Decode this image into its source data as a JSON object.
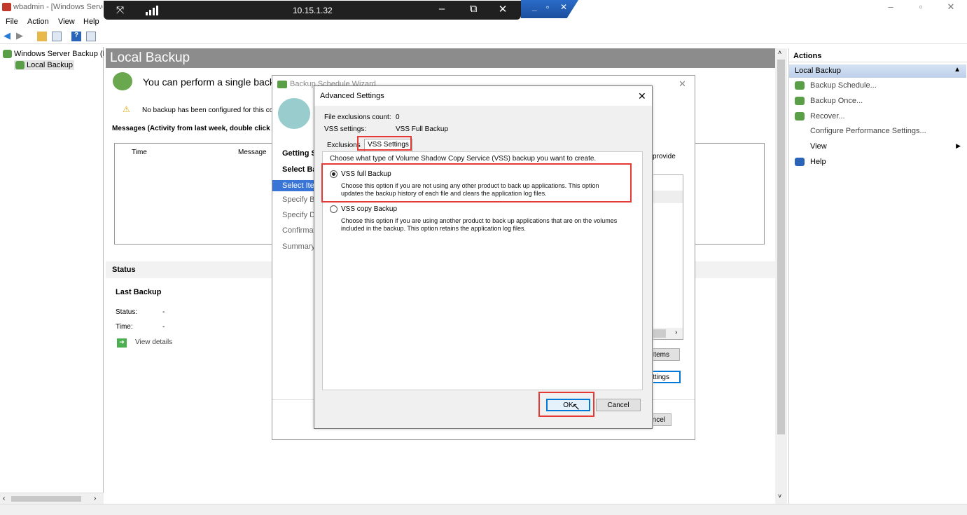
{
  "window": {
    "title": "wbadmin - [Windows Server Backup (Local)\\Local Backup]",
    "minimize_icon": "minimize-icon",
    "restore_icon": "restore-icon",
    "close_icon": "close-icon"
  },
  "remote_bar": {
    "ip": "10.15.1.32",
    "pin_icon": "unpin-icon",
    "signal_icon": "signal-strength-icon",
    "minimize": "–",
    "restore": "⧉",
    "close": "✕",
    "inner_controls": "_ ▫ ✕"
  },
  "menu": {
    "file": "File",
    "action": "Action",
    "view": "View",
    "help": "Help"
  },
  "tree": {
    "root": "Windows Server Backup (Local)",
    "child": "Local Backup"
  },
  "center": {
    "header": "Local Backup",
    "intro": "You can perform a single backup or schedule a regular backup using this application.",
    "warning": "No backup has been configured for this computer.",
    "messages_heading": "Messages (Activity from last week, double click on the message to see details)",
    "col_time": "Time",
    "col_message": "Message",
    "status_heading": "Status",
    "last_backup": "Last Backup",
    "status_label": "Status:",
    "status_value": "-",
    "time_label": "Time:",
    "time_value": "-",
    "view_details": "View details"
  },
  "actions": {
    "title": "Actions",
    "group": "Local Backup",
    "items": [
      "Backup Schedule...",
      "Backup Once...",
      "Recover...",
      "Configure Performance Settings...",
      "View",
      "Help"
    ]
  },
  "wizard": {
    "title": "Backup Schedule Wizard",
    "steps": [
      "Getting Started",
      "Select Backup Configuration",
      "Select Items for Backup",
      "Specify Backup Time",
      "Specify Destination Type",
      "Confirmation",
      "Summary"
    ],
    "right_text": "provide",
    "btn_items": "Add Items",
    "btn_settings": "Advanced Settings",
    "btn_cancel": "Cancel"
  },
  "dialog": {
    "title": "Advanced Settings",
    "file_exclusions_label": "File exclusions count:",
    "file_exclusions_value": "0",
    "vss_settings_label": "VSS settings:",
    "vss_settings_value": "VSS Full Backup",
    "tab_exclusions": "Exclusions",
    "tab_vss": "VSS Settings",
    "instruction": "Choose what type of Volume Shadow Copy Service (VSS) backup you want to create.",
    "option_full": "VSS full Backup",
    "option_full_desc_1": "Choose this option if you are not using any other product to back up applications. This option",
    "option_full_desc_2": "updates the backup history of each file and clears the application log files.",
    "option_copy": "VSS copy Backup",
    "option_copy_desc_1": "Choose this option if you are using another product to back up applications that are on the volumes",
    "option_copy_desc_2": "included in the backup. This option retains the application log files.",
    "ok": "OK",
    "cancel": "Cancel",
    "selected_option": "VSS full Backup"
  },
  "colors": {
    "header_gray": "#8c8c8c",
    "highlight_red": "#e53935",
    "selection_blue": "#3875d7"
  }
}
